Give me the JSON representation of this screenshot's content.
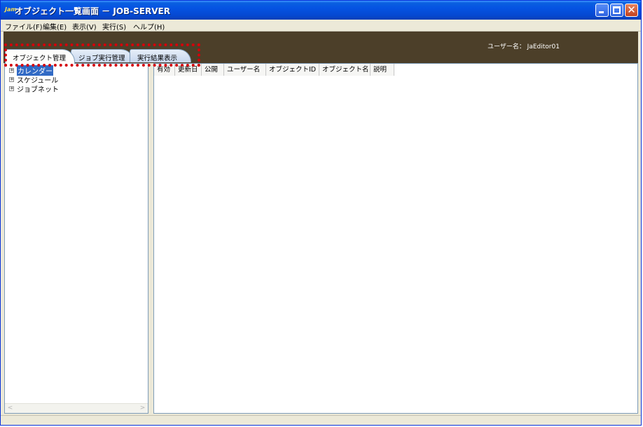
{
  "window": {
    "app_icon": "Jam",
    "title": "オブジェクト一覧画面 － JOB-SERVER"
  },
  "menu": [
    {
      "label": "ファイル(F)"
    },
    {
      "label": "編集(E)"
    },
    {
      "label": "表示(V)"
    },
    {
      "label": "実行(S)"
    },
    {
      "label": "ヘルプ(H)"
    }
  ],
  "header": {
    "username": "ユーザー名： JaEditor01"
  },
  "tabs": [
    {
      "label": "オブジェクト管理",
      "active": true
    },
    {
      "label": "ジョブ実行管理",
      "active": false
    },
    {
      "label": "実行結果表示",
      "active": false
    }
  ],
  "tree": {
    "items": [
      {
        "label": "カレンダー",
        "selected": true
      },
      {
        "label": "スケジュール",
        "selected": false
      },
      {
        "label": "ジョブネット",
        "selected": false
      }
    ]
  },
  "list": {
    "columns": [
      "有効",
      "更新日",
      "公開",
      "ユーザー名",
      "オブジェクトID",
      "オブジェクト名",
      "説明"
    ]
  },
  "colors": {
    "banner": "#4c3f29",
    "selection": "#316ac5",
    "highlight_border": "#d4000a"
  }
}
